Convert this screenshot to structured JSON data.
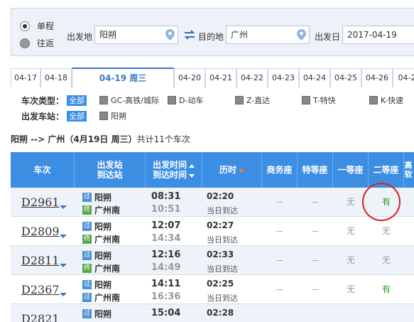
{
  "search": {
    "trip_types": [
      {
        "label": "单程",
        "selected": true
      },
      {
        "label": "往返",
        "selected": false
      }
    ],
    "from_label": "出发地",
    "from_value": "阳朔",
    "to_label": "目的地",
    "to_value": "广州",
    "date_label": "出发日",
    "date_value": "2017-04-19"
  },
  "date_tabs": [
    "04-17",
    "04-18",
    "04-19  周三",
    "04-20",
    "04-21",
    "04-22",
    "04-23",
    "04-24",
    "04-25",
    "04-26",
    "04-2"
  ],
  "selected_tab": 2,
  "filters": {
    "type_label": "车次类型：",
    "type_all": "全部",
    "types": [
      "GC-高铁/城际",
      "D-动车",
      "Z-直达",
      "T-特快",
      "K-快速"
    ],
    "station_label": "出发车站：",
    "station_all": "全部",
    "stations": [
      "阳朔"
    ]
  },
  "summary": {
    "route": "阳朔  -->  广州（4月19日  周三）",
    "count": "共计11个车次"
  },
  "table": {
    "headers": {
      "train": "车次",
      "station_a": "出发站",
      "station_b": "到达站",
      "time_a": "出发时间",
      "time_b": "到达时间",
      "duration": "历时",
      "business": "商务座",
      "special": "特等座",
      "first": "一等座",
      "second": "二等座",
      "more": "高软"
    },
    "badge_pass": "过",
    "badge_end": "终",
    "rows": [
      {
        "train": "D2961",
        "from": "阳朔",
        "to": "广州南",
        "dep": "08:31",
        "arr": "10:51",
        "dur": "02:20",
        "day": "当日到达",
        "business": "--",
        "special": "--",
        "first": "无",
        "second": "有"
      },
      {
        "train": "D2809",
        "from": "阳朔",
        "to": "广州南",
        "dep": "12:07",
        "arr": "14:34",
        "dur": "02:27",
        "day": "当日到达",
        "business": "--",
        "special": "--",
        "first": "无",
        "second": "无"
      },
      {
        "train": "D2811",
        "from": "阳朔",
        "to": "广州南",
        "dep": "12:16",
        "arr": "14:49",
        "dur": "02:33",
        "day": "当日到达",
        "business": "--",
        "special": "--",
        "first": "无",
        "second": "无"
      },
      {
        "train": "D2367",
        "from": "阳朔",
        "to": "广州南",
        "dep": "14:11",
        "arr": "16:36",
        "dur": "02:25",
        "day": "当日到达",
        "business": "--",
        "special": "--",
        "first": "无",
        "second": "有"
      },
      {
        "train": "D2821",
        "from": "阳朔",
        "to": "",
        "dep": "15:04",
        "arr": "",
        "dur": "02:28",
        "day": "",
        "business": "",
        "special": "",
        "first": "",
        "second": ""
      }
    ]
  },
  "colors": {
    "header_blue": "#3c8ee3",
    "available_green": "#2a9a2a",
    "highlight_red": "#d82020"
  }
}
